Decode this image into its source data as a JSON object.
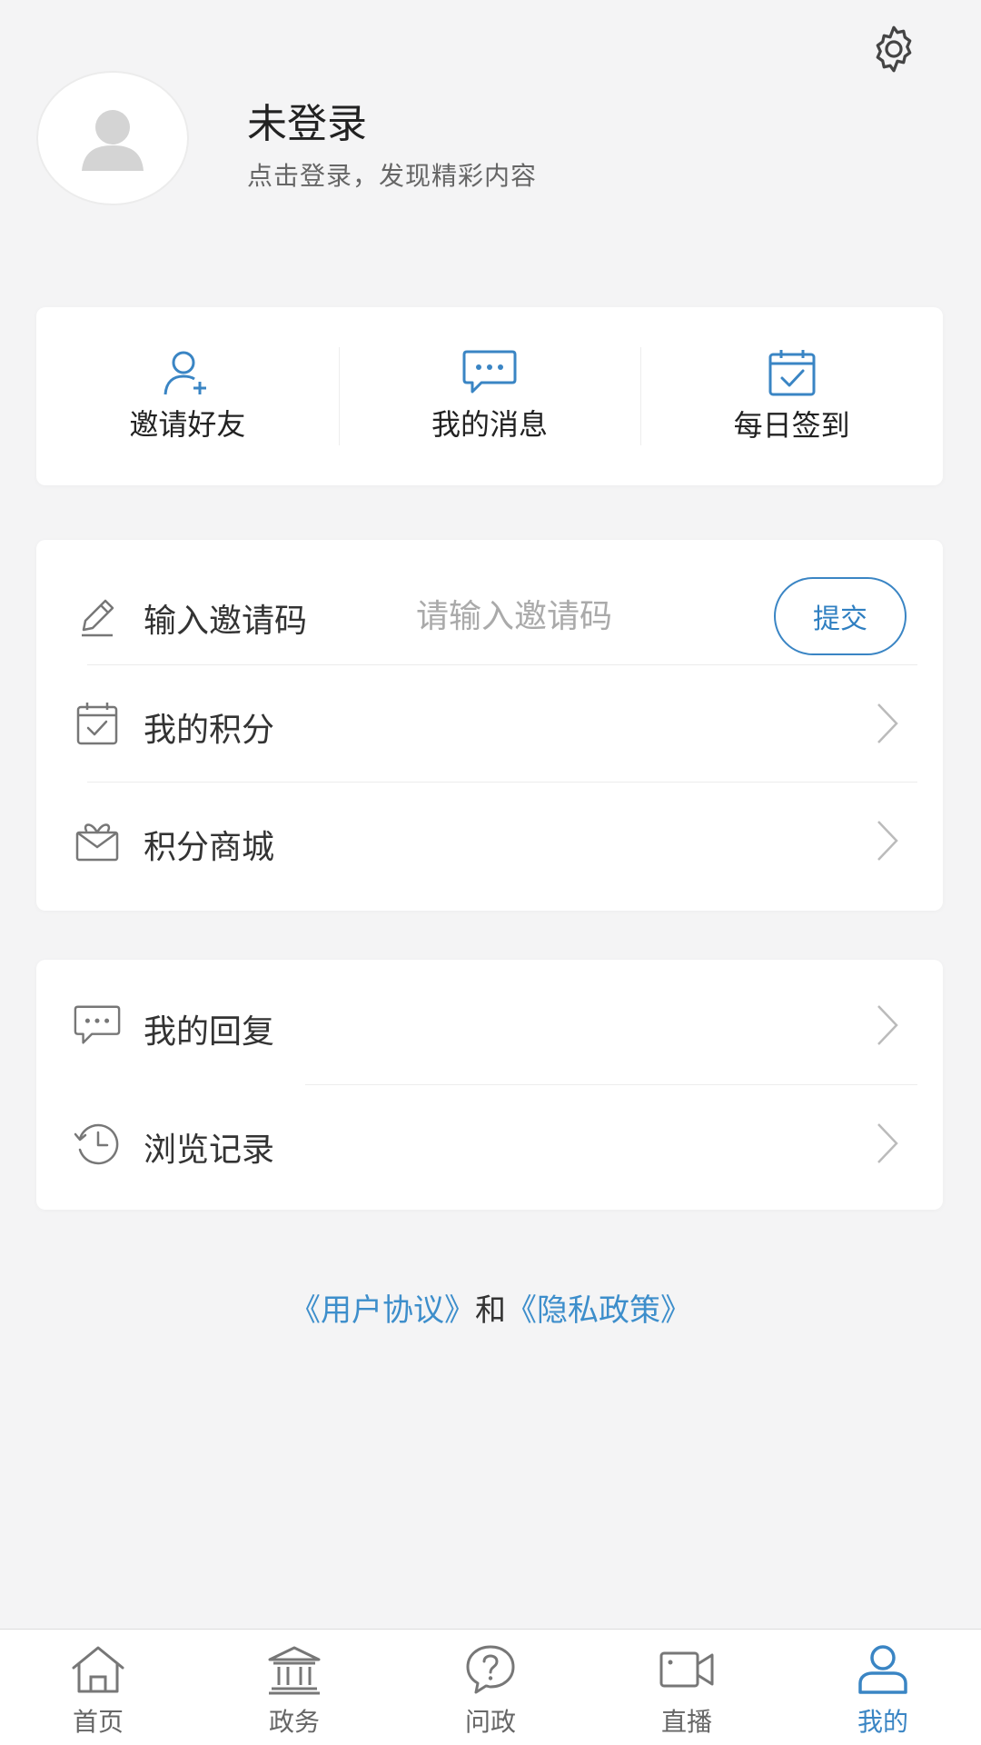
{
  "header": {
    "title": "未登录",
    "subtitle": "点击登录，发现精彩内容",
    "settings_icon": "gear-icon",
    "avatar_icon": "user-placeholder-icon"
  },
  "quick_actions": [
    {
      "label": "邀请好友",
      "icon": "add-user-icon"
    },
    {
      "label": "我的消息",
      "icon": "message-bubble-icon"
    },
    {
      "label": "每日签到",
      "icon": "calendar-check-icon"
    }
  ],
  "invite": {
    "label": "输入邀请码",
    "placeholder": "请输入邀请码",
    "value": "",
    "submit_label": "提交",
    "icon": "pencil-icon"
  },
  "menu_group1": [
    {
      "label": "我的积分",
      "icon": "calendar-check-icon"
    },
    {
      "label": "积分商城",
      "icon": "gift-box-icon"
    }
  ],
  "menu_group2": [
    {
      "label": "我的回复",
      "icon": "comment-icon"
    },
    {
      "label": "浏览记录",
      "icon": "history-clock-icon"
    }
  ],
  "agreement": {
    "link1": "《用户协议》",
    "joiner": "和",
    "link2": "《隐私政策》"
  },
  "tabs": [
    {
      "label": "首页",
      "icon": "home-icon"
    },
    {
      "label": "政务",
      "icon": "government-building-icon"
    },
    {
      "label": "问政",
      "icon": "question-bubble-icon"
    },
    {
      "label": "直播",
      "icon": "video-camera-icon"
    },
    {
      "label": "我的",
      "icon": "profile-icon",
      "active": true
    }
  ],
  "colors": {
    "accent": "#3a85c4",
    "link": "#3d8ecb",
    "background": "#f4f4f5"
  }
}
